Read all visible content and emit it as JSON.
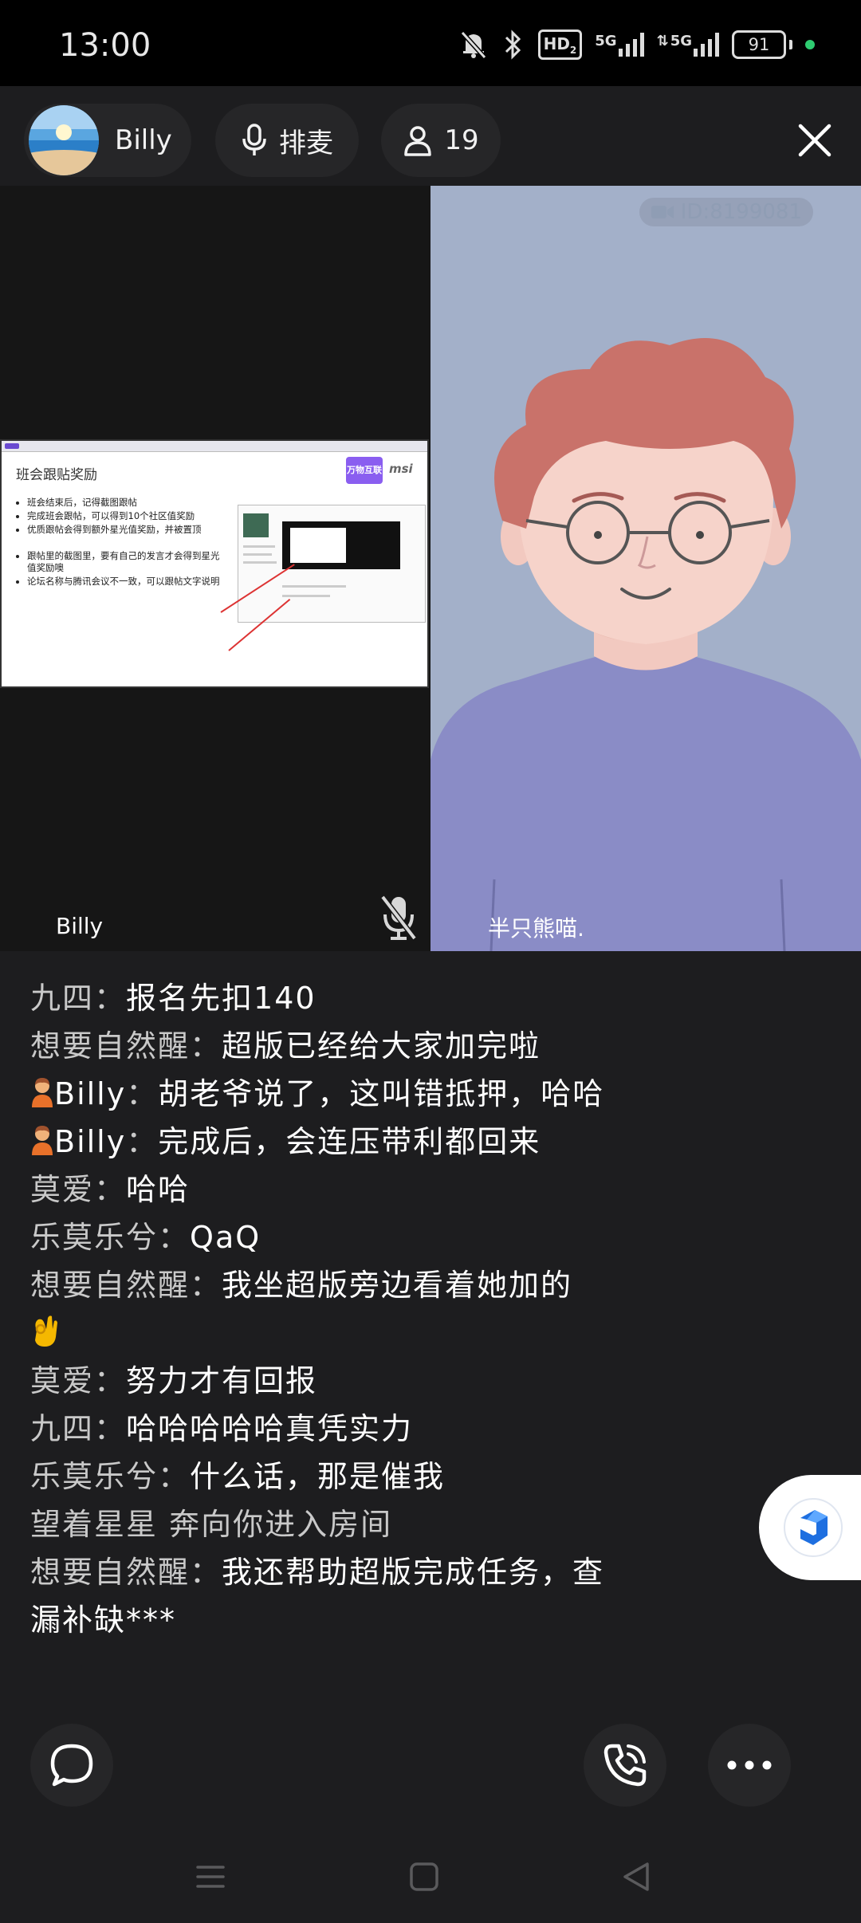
{
  "status_bar": {
    "time": "13:00",
    "hd_label": "HD",
    "network1": "5G",
    "network2": "5G",
    "battery": "91"
  },
  "topbar": {
    "host_name": "Billy",
    "mic_queue_label": "排麦",
    "participant_count": "19"
  },
  "video": {
    "slide": {
      "title": "班会跟贴奖励",
      "logo_text": "万物互联",
      "brand": "msi",
      "bullets": [
        "班会结束后，记得截图跟帖",
        "完成班会跟帖，可以得到10个社区值奖励",
        "优质跟帖会得到额外星光值奖励，并被置顶",
        "跟帖里的截图里，要有自己的发言才会得到星光值奖励噢",
        "论坛名称与腾讯会议不一致，可以跟帖文字说明"
      ]
    },
    "watermark": "ID:8199081",
    "left_label": "Billy",
    "right_label": "半只熊喵."
  },
  "chat": {
    "messages": [
      {
        "nick": "九四",
        "text": "报名先扣140"
      },
      {
        "nick": "想要自然醒",
        "text": "超版已经给大家加完啦"
      },
      {
        "nick": "Billy",
        "text": "胡老爷说了，这叫错抵押，哈哈"
      },
      {
        "nick": "Billy",
        "text": "完成后，会连压带利都回来"
      },
      {
        "nick": "莫爱",
        "text": "哈哈"
      },
      {
        "nick": "乐莫乐兮",
        "text": "QaQ"
      },
      {
        "nick": "想要自然醒",
        "text": "我坐超版旁边看着她加的"
      },
      {
        "nick": "莫爱",
        "text": "努力才有回报"
      },
      {
        "nick": "九四",
        "text": "哈哈哈哈哈真凭实力"
      },
      {
        "nick": "乐莫乐兮",
        "text": "什么话，那是催我"
      },
      {
        "nick": "",
        "text": "望着星星 奔向你进入房间"
      },
      {
        "nick": "想要自然醒",
        "text": "我还帮助超版完成任务，查漏补缺***"
      }
    ],
    "separator": "："
  },
  "icons": {
    "chat": "chat-bubble-icon",
    "call": "phone-call-icon",
    "more": "more-dots-icon"
  },
  "colors": {
    "background": "#1d1d1f",
    "video_bg": "#a3b0c9",
    "shirt": "#8a8cc6",
    "hair": "#c9726a"
  }
}
